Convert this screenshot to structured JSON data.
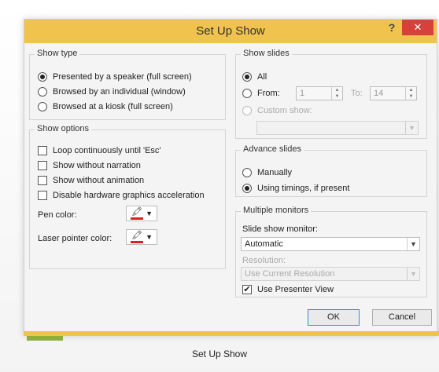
{
  "dialog": {
    "title": "Set Up Show",
    "help": "?",
    "close": "✕"
  },
  "show_type": {
    "legend": "Show type",
    "options": [
      {
        "label": "Presented by a speaker (full screen)",
        "selected": true
      },
      {
        "label": "Browsed by an individual (window)",
        "selected": false
      },
      {
        "label": "Browsed at a kiosk (full screen)",
        "selected": false
      }
    ]
  },
  "show_options": {
    "legend": "Show options",
    "checks": [
      {
        "label": "Loop continuously until 'Esc'",
        "checked": false
      },
      {
        "label": "Show without narration",
        "checked": false
      },
      {
        "label": "Show without animation",
        "checked": false
      },
      {
        "label": "Disable hardware graphics acceleration",
        "checked": false
      }
    ],
    "pen_color_label": "Pen color:",
    "laser_color_label": "Laser pointer color:",
    "pen_color": "#e02020",
    "laser_color": "#e02020"
  },
  "show_slides": {
    "legend": "Show slides",
    "all_label": "All",
    "from_label": "From:",
    "from_value": "1",
    "to_label": "To:",
    "to_value": "14",
    "custom_label": "Custom show:",
    "custom_value": ""
  },
  "advance_slides": {
    "legend": "Advance slides",
    "manually": "Manually",
    "timings": "Using timings, if present"
  },
  "monitors": {
    "legend": "Multiple monitors",
    "monitor_label": "Slide show monitor:",
    "monitor_value": "Automatic",
    "resolution_label": "Resolution:",
    "resolution_value": "Use Current Resolution",
    "presenter_label": "Use Presenter View",
    "presenter_checked": true
  },
  "buttons": {
    "ok": "OK",
    "cancel": "Cancel"
  },
  "caption": "Set Up Show",
  "colors": {
    "titlebar": "#f0c24e",
    "close": "#d6413b"
  }
}
